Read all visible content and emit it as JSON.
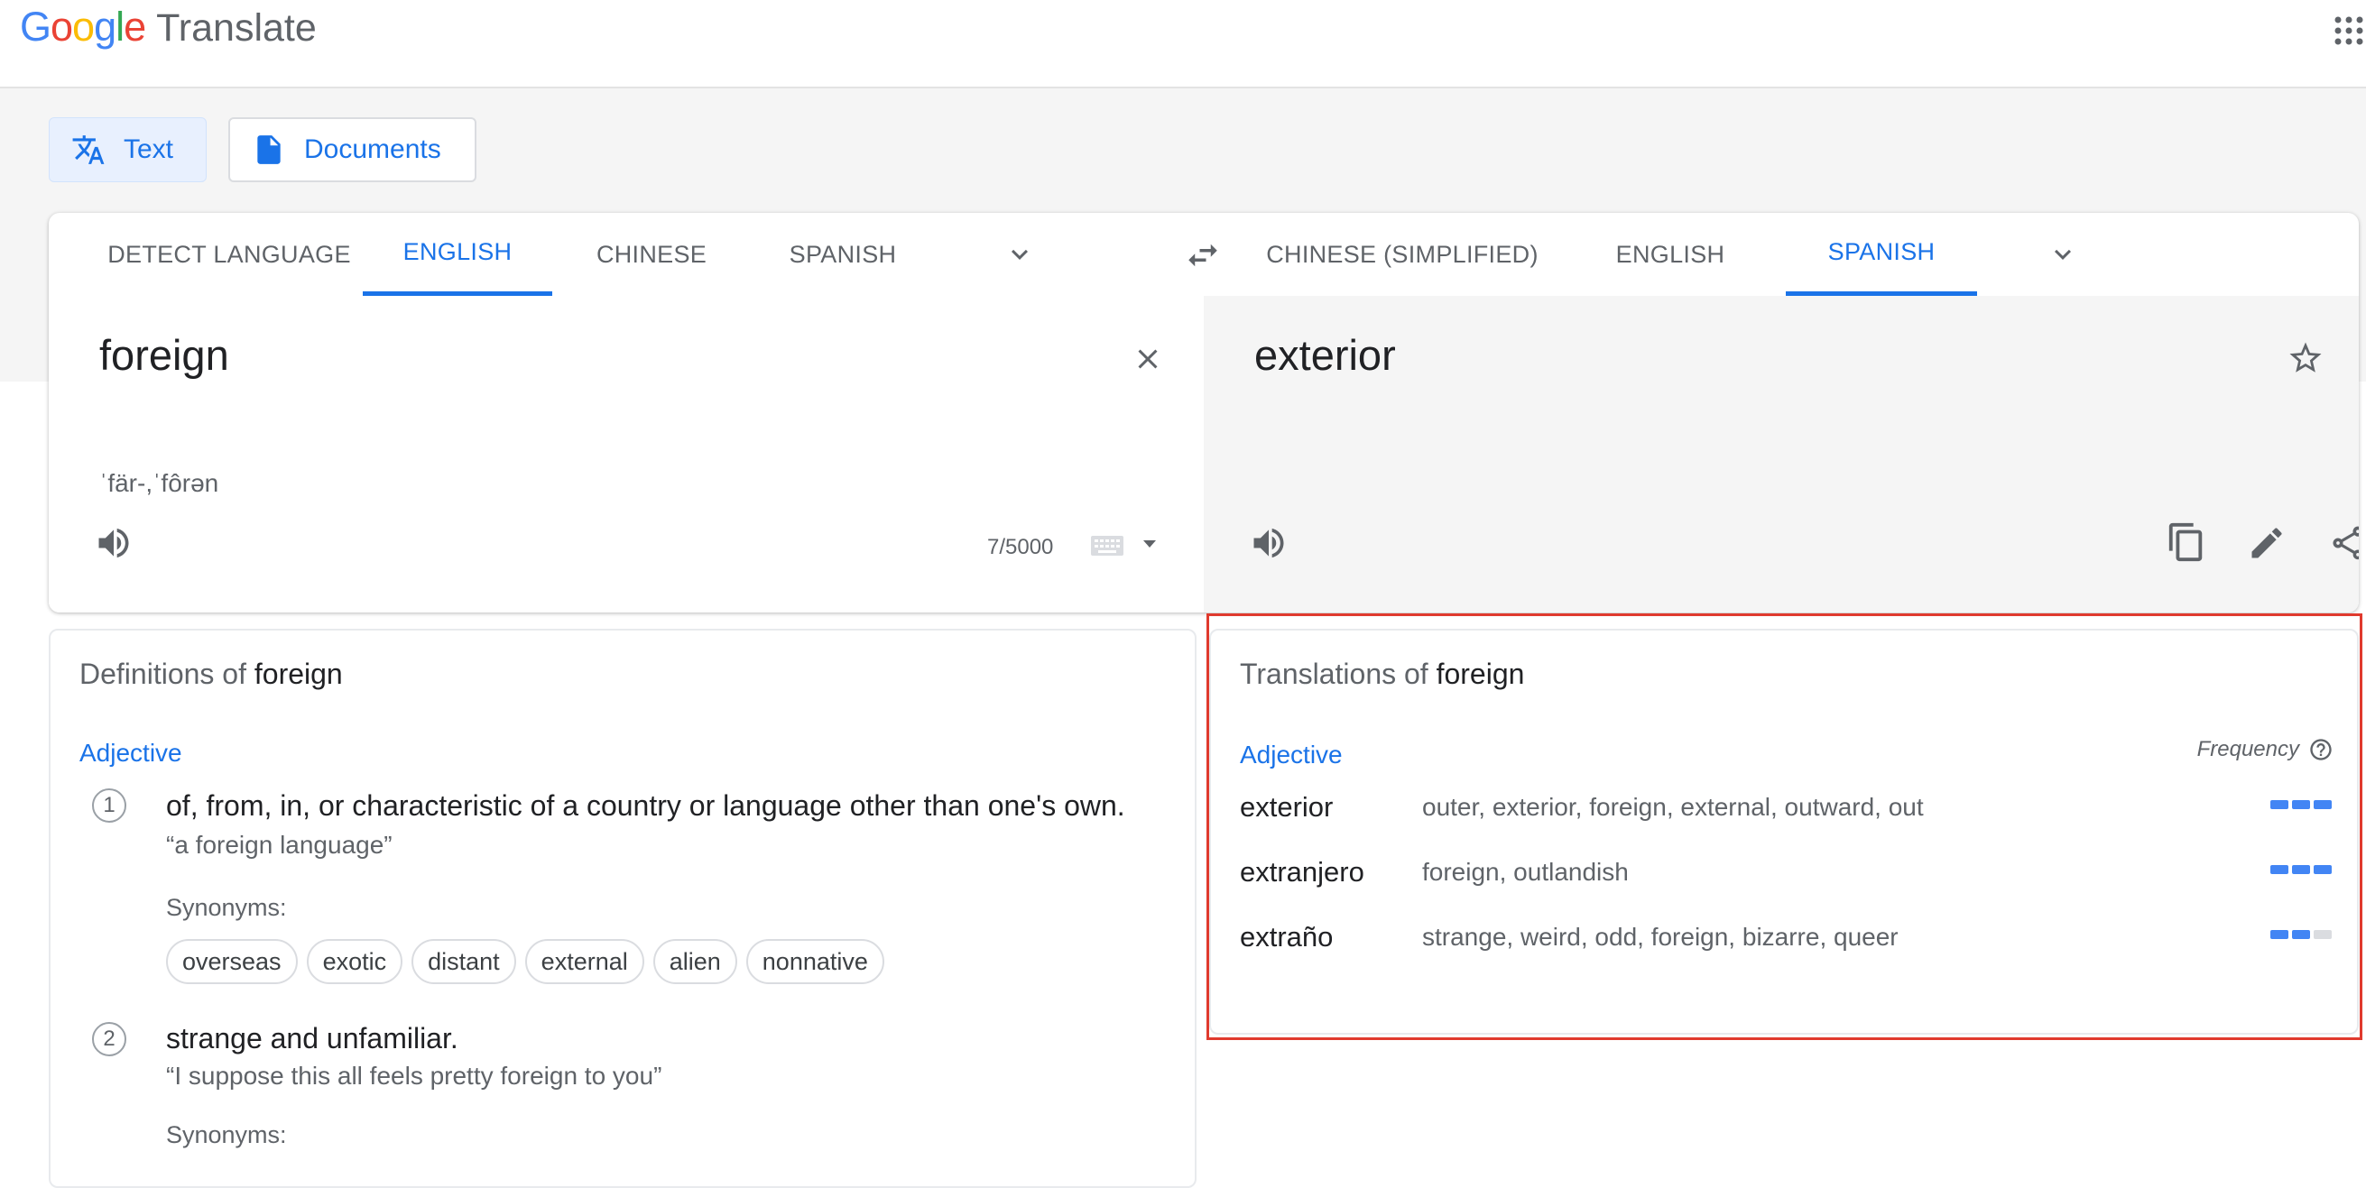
{
  "app": {
    "logo_letters": [
      "G",
      "o",
      "o",
      "g",
      "l",
      "e"
    ],
    "logo_colors": [
      "#4285F4",
      "#EA4335",
      "#FBBC05",
      "#4285F4",
      "#34A853",
      "#EA4335"
    ],
    "product": "Translate"
  },
  "modes": {
    "text": "Text",
    "documents": "Documents"
  },
  "source_langs": [
    "DETECT LANGUAGE",
    "ENGLISH",
    "CHINESE",
    "SPANISH"
  ],
  "target_langs": [
    "CHINESE (SIMPLIFIED)",
    "ENGLISH",
    "SPANISH"
  ],
  "source": {
    "text": "foreign",
    "phonetic": "ˈfär-,ˈfôrən",
    "char_count": "7/5000"
  },
  "target": {
    "text": "exterior"
  },
  "definitions": {
    "title_prefix": "Definitions of",
    "word": "foreign",
    "pos": "Adjective",
    "synonyms_label": "Synonyms:",
    "items": [
      {
        "num": "1",
        "text": "of, from, in, or characteristic of a country or language other than one's own.",
        "example": "“a foreign language”",
        "synonyms": [
          "overseas",
          "exotic",
          "distant",
          "external",
          "alien",
          "nonnative"
        ]
      },
      {
        "num": "2",
        "text": "strange and unfamiliar.",
        "example": "“I suppose this all feels pretty foreign to you”"
      }
    ]
  },
  "translations": {
    "title_prefix": "Translations of",
    "word": "foreign",
    "pos": "Adjective",
    "frequency_label": "Frequency",
    "rows": [
      {
        "word": "exterior",
        "synonyms": "outer, exterior, foreign, external, outward, out",
        "frequency": 3
      },
      {
        "word": "extranjero",
        "synonyms": "foreign, outlandish",
        "frequency": 3
      },
      {
        "word": "extraño",
        "synonyms": "strange, weird, odd, foreign, bizarre, queer",
        "frequency": 2
      }
    ]
  },
  "colors": {
    "accent": "#1a73e8",
    "highlight_box": "#e03a2e"
  }
}
